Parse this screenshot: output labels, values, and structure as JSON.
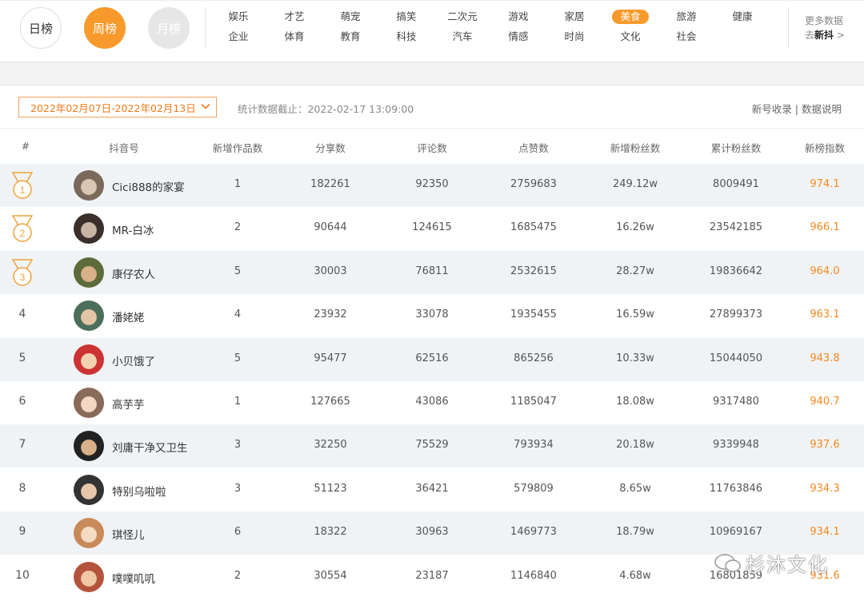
{
  "period_tabs": {
    "day": "日榜",
    "week": "周榜",
    "month": "月榜"
  },
  "categories_row1": [
    "娱乐",
    "才艺",
    "萌宠",
    "搞笑",
    "二次元",
    "游戏",
    "家居",
    "美食",
    "旅游",
    "健康"
  ],
  "categories_row2": [
    "企业",
    "体育",
    "教育",
    "科技",
    "汽车",
    "情感",
    "时尚",
    "文化",
    "社会"
  ],
  "active_category": "美食",
  "more": {
    "line1": "更多数据",
    "line2_prefix": "去",
    "line2_bold": "新抖",
    "arrow": ">"
  },
  "toolbar": {
    "date_range": "2022年02月07日-2022年02月13日",
    "stat_label": "统计数据截止：2022-02-17 13:09:00",
    "link_new": "新号收录",
    "link_sep": " | ",
    "link_desc": "数据说明"
  },
  "headers": [
    "#",
    "抖音号",
    "新增作品数",
    "分享数",
    "评论数",
    "点赞数",
    "新增粉丝数",
    "累计粉丝数",
    "新榜指数"
  ],
  "rows": [
    {
      "rank": "1",
      "name": "Cici888的家宴",
      "works": "1",
      "shares": "182261",
      "comments": "92350",
      "likes": "2759683",
      "new_fans": "249.12w",
      "total_fans": "8009491",
      "score": "974.1"
    },
    {
      "rank": "2",
      "name": "MR-白冰",
      "works": "2",
      "shares": "90644",
      "comments": "124615",
      "likes": "1685475",
      "new_fans": "16.26w",
      "total_fans": "23542185",
      "score": "966.1"
    },
    {
      "rank": "3",
      "name": "康仔农人",
      "works": "5",
      "shares": "30003",
      "comments": "76811",
      "likes": "2532615",
      "new_fans": "28.27w",
      "total_fans": "19836642",
      "score": "964.0"
    },
    {
      "rank": "4",
      "name": "潘姥姥",
      "works": "4",
      "shares": "23932",
      "comments": "33078",
      "likes": "1935455",
      "new_fans": "16.59w",
      "total_fans": "27899373",
      "score": "963.1"
    },
    {
      "rank": "5",
      "name": "小贝饿了",
      "works": "5",
      "shares": "95477",
      "comments": "62516",
      "likes": "865256",
      "new_fans": "10.33w",
      "total_fans": "15044050",
      "score": "943.8"
    },
    {
      "rank": "6",
      "name": "高芋芋",
      "works": "1",
      "shares": "127665",
      "comments": "43086",
      "likes": "1185047",
      "new_fans": "18.08w",
      "total_fans": "9317480",
      "score": "940.7"
    },
    {
      "rank": "7",
      "name": "刘庸干净又卫生",
      "works": "3",
      "shares": "32250",
      "comments": "75529",
      "likes": "793934",
      "new_fans": "20.18w",
      "total_fans": "9339948",
      "score": "937.6"
    },
    {
      "rank": "8",
      "name": "特别乌啦啦",
      "works": "3",
      "shares": "51123",
      "comments": "36421",
      "likes": "579809",
      "new_fans": "8.65w",
      "total_fans": "11763846",
      "score": "934.3"
    },
    {
      "rank": "9",
      "name": "琪怪儿",
      "works": "6",
      "shares": "18322",
      "comments": "30963",
      "likes": "1469773",
      "new_fans": "18.79w",
      "total_fans": "10969167",
      "score": "934.1"
    },
    {
      "rank": "10",
      "name": "噗噗叽叽",
      "works": "2",
      "shares": "30554",
      "comments": "23187",
      "likes": "1146840",
      "new_fans": "4.68w",
      "total_fans": "16801859",
      "score": "931.6"
    }
  ],
  "watermark": "杉沐文化",
  "colors": {
    "accent": "#f79a2b",
    "score": "#f5881f",
    "row_alt": "#f0f3f5"
  }
}
